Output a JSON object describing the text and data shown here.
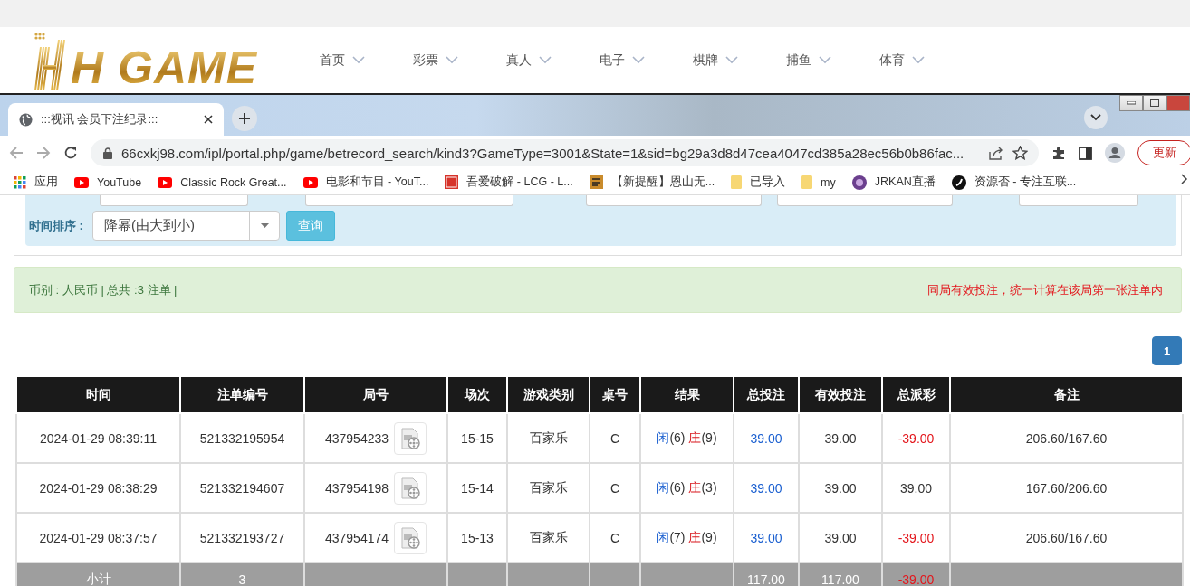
{
  "top_nav": {
    "logo": "H GAME",
    "items": [
      {
        "label": "首页"
      },
      {
        "label": "彩票"
      },
      {
        "label": "真人"
      },
      {
        "label": "电子"
      },
      {
        "label": "棋牌"
      },
      {
        "label": "捕鱼"
      },
      {
        "label": "体育"
      }
    ]
  },
  "browser": {
    "tab_title": ":::视讯 会员下注纪录:::",
    "url": "66cxkj98.com/ipl/portal.php/game/betrecord_search/kind3?GameType=3001&State=1&sid=bg29a3d8d47cea4047cd385a28ec56b0b86fac...",
    "update_button": "更新",
    "bookmarks": [
      {
        "label": "应用",
        "kind": "apps"
      },
      {
        "label": "YouTube",
        "kind": "youtube"
      },
      {
        "label": "Classic Rock Great...",
        "kind": "youtube"
      },
      {
        "label": "电影和节目 - YouT...",
        "kind": "youtube"
      },
      {
        "label": "吾爱破解 - LCG - L...",
        "kind": "seal"
      },
      {
        "label": "【新提醒】恩山无...",
        "kind": "square"
      },
      {
        "label": "已导入",
        "kind": "folder"
      },
      {
        "label": "my",
        "kind": "folder"
      },
      {
        "label": "JRKAN直播",
        "kind": "orb"
      },
      {
        "label": "资源否 - 专注互联...",
        "kind": "round"
      }
    ]
  },
  "filter": {
    "sort_label": "时间排序 :",
    "sort_value": "降幂(由大到小)",
    "query_button": "查询"
  },
  "summary": {
    "text": "币别 : 人民币 | 总共 :3 注单 |",
    "notice": "同局有效投注，统一计算在该局第一张注单内"
  },
  "pagination": [
    {
      "label": "1",
      "selected": true
    }
  ],
  "table": {
    "columns": [
      "时间",
      "注单编号",
      "局号",
      "场次",
      "游戏类别",
      "桌号",
      "结果",
      "总投注",
      "有效投注",
      "总派彩",
      "备注"
    ],
    "rows": [
      {
        "time": "2024-01-29 08:39:11",
        "bet_no": "521332195954",
        "round_no": "437954233",
        "session": "15-15",
        "game_type": "百家乐",
        "table_no": "C",
        "result": [
          {
            "label": "闲",
            "score": "(6)"
          },
          {
            "label": "庄",
            "score": "(9)"
          }
        ],
        "total_bet": "39.00",
        "valid_bet": "39.00",
        "payout": "-39.00",
        "payout_negative": true,
        "note": "206.60/167.60"
      },
      {
        "time": "2024-01-29 08:38:29",
        "bet_no": "521332194607",
        "round_no": "437954198",
        "session": "15-14",
        "game_type": "百家乐",
        "table_no": "C",
        "result": [
          {
            "label": "闲",
            "score": "(6)"
          },
          {
            "label": "庄",
            "score": "(3)"
          }
        ],
        "total_bet": "39.00",
        "valid_bet": "39.00",
        "payout": "39.00",
        "payout_negative": false,
        "note": "167.60/206.60"
      },
      {
        "time": "2024-01-29 08:37:57",
        "bet_no": "521332193727",
        "round_no": "437954174",
        "session": "15-13",
        "game_type": "百家乐",
        "table_no": "C",
        "result": [
          {
            "label": "闲",
            "score": "(7)"
          },
          {
            "label": "庄",
            "score": "(9)"
          }
        ],
        "total_bet": "39.00",
        "valid_bet": "39.00",
        "payout": "-39.00",
        "payout_negative": true,
        "note": "206.60/167.60"
      }
    ],
    "subtotal": {
      "label": "小计",
      "count": "3",
      "total_bet": "117.00",
      "valid_bet": "117.00",
      "payout": "-39.00",
      "payout_negative": true
    }
  }
}
